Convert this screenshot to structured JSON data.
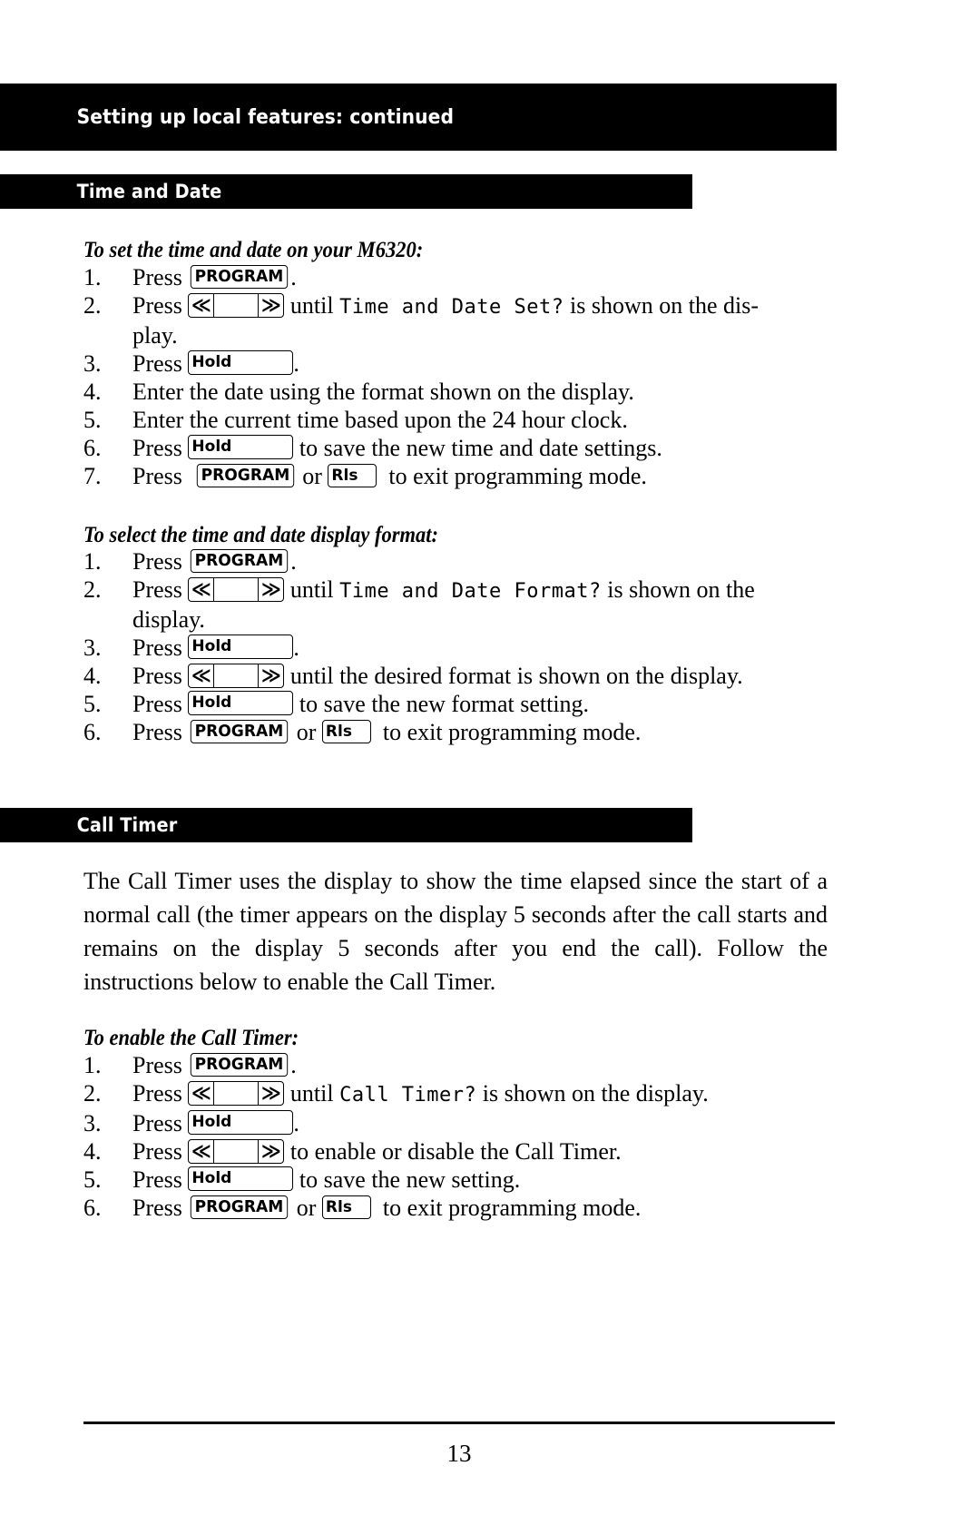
{
  "header": {
    "title": "Setting up local features: continued"
  },
  "sections": [
    {
      "bar_label": "Time and Date",
      "subsections": [
        {
          "heading": "To set the time and date on your M6320:",
          "steps": [
            {
              "num": "1.",
              "parts": [
                {
                  "t": "text",
                  "v": "Press "
                },
                {
                  "t": "key",
                  "kind": "program",
                  "label": "PROGRAM"
                },
                {
                  "t": "text",
                  "v": "."
                }
              ]
            },
            {
              "num": "2.",
              "parts": [
                {
                  "t": "text",
                  "v": "Press "
                },
                {
                  "t": "key",
                  "kind": "nav",
                  "left": "≪",
                  "right": "≫"
                },
                {
                  "t": "text",
                  "v": " until "
                },
                {
                  "t": "display",
                  "v": "Time and Date Set?"
                },
                {
                  "t": "text",
                  "v": " is shown on the dis-"
                },
                {
                  "t": "break"
                },
                {
                  "t": "text",
                  "v": "play."
                }
              ]
            },
            {
              "num": "3.",
              "parts": [
                {
                  "t": "text",
                  "v": "Press "
                },
                {
                  "t": "key",
                  "kind": "hold",
                  "label": "Hold"
                },
                {
                  "t": "text",
                  "v": "."
                }
              ]
            },
            {
              "num": "4.",
              "parts": [
                {
                  "t": "text",
                  "v": "Enter the date using the format shown on the display."
                }
              ]
            },
            {
              "num": "5.",
              "parts": [
                {
                  "t": "text",
                  "v": "Enter the current time based upon the 24 hour clock."
                }
              ]
            },
            {
              "num": "6.",
              "parts": [
                {
                  "t": "text",
                  "v": "Press "
                },
                {
                  "t": "key",
                  "kind": "hold",
                  "label": "Hold"
                },
                {
                  "t": "text",
                  "v": " to save the new time and date settings."
                }
              ]
            },
            {
              "num": "7.",
              "parts": [
                {
                  "t": "text",
                  "v": "Press  "
                },
                {
                  "t": "key",
                  "kind": "program",
                  "label": "PROGRAM"
                },
                {
                  "t": "text",
                  "v": " or "
                },
                {
                  "t": "key",
                  "kind": "rls",
                  "label": "Rls"
                },
                {
                  "t": "text",
                  "v": "  to exit programming mode."
                }
              ]
            }
          ]
        },
        {
          "heading": "To select the time and date display format:",
          "steps": [
            {
              "num": "1.",
              "parts": [
                {
                  "t": "text",
                  "v": "Press "
                },
                {
                  "t": "key",
                  "kind": "program",
                  "label": "PROGRAM"
                },
                {
                  "t": "text",
                  "v": "."
                }
              ]
            },
            {
              "num": "2.",
              "parts": [
                {
                  "t": "text",
                  "v": "Press "
                },
                {
                  "t": "key",
                  "kind": "nav",
                  "left": "≪",
                  "right": "≫"
                },
                {
                  "t": "text",
                  "v": " until "
                },
                {
                  "t": "display",
                  "v": "Time and Date Format?"
                },
                {
                  "t": "text",
                  "v": " is shown on the"
                },
                {
                  "t": "break"
                },
                {
                  "t": "text",
                  "v": "display."
                }
              ]
            },
            {
              "num": "3.",
              "parts": [
                {
                  "t": "text",
                  "v": "Press "
                },
                {
                  "t": "key",
                  "kind": "hold",
                  "label": "Hold"
                },
                {
                  "t": "text",
                  "v": "."
                }
              ]
            },
            {
              "num": "4.",
              "parts": [
                {
                  "t": "text",
                  "v": "Press "
                },
                {
                  "t": "key",
                  "kind": "nav",
                  "left": "≪",
                  "right": "≫"
                },
                {
                  "t": "text",
                  "v": " until the desired format is shown on the display."
                }
              ]
            },
            {
              "num": "5.",
              "parts": [
                {
                  "t": "text",
                  "v": "Press "
                },
                {
                  "t": "key",
                  "kind": "hold",
                  "label": "Hold"
                },
                {
                  "t": "text",
                  "v": " to save the new format setting."
                }
              ]
            },
            {
              "num": "6.",
              "parts": [
                {
                  "t": "text",
                  "v": "Press "
                },
                {
                  "t": "key",
                  "kind": "program",
                  "label": "PROGRAM"
                },
                {
                  "t": "text",
                  "v": " or "
                },
                {
                  "t": "key",
                  "kind": "rls",
                  "label": "Rls"
                },
                {
                  "t": "text",
                  "v": "  to exit programming mode."
                }
              ]
            }
          ]
        }
      ]
    },
    {
      "bar_label": "Call Timer",
      "paragraph": "The Call Timer uses the display to show the time elapsed since the start of a normal call (the timer appears on the display 5 seconds after the call starts and remains on the display 5 seconds after you end the call). Follow the instructions below to enable the Call Timer.",
      "subsections": [
        {
          "heading": "To enable the Call Timer:",
          "steps": [
            {
              "num": "1.",
              "parts": [
                {
                  "t": "text",
                  "v": "Press "
                },
                {
                  "t": "key",
                  "kind": "program",
                  "label": "PROGRAM"
                },
                {
                  "t": "text",
                  "v": "."
                }
              ]
            },
            {
              "num": "2.",
              "parts": [
                {
                  "t": "text",
                  "v": "Press "
                },
                {
                  "t": "key",
                  "kind": "nav",
                  "left": "≪",
                  "right": "≫"
                },
                {
                  "t": "text",
                  "v": " until "
                },
                {
                  "t": "display",
                  "v": "Call Timer?"
                },
                {
                  "t": "text",
                  "v": " is shown on the display."
                }
              ]
            },
            {
              "num": "3.",
              "parts": [
                {
                  "t": "text",
                  "v": "Press "
                },
                {
                  "t": "key",
                  "kind": "hold",
                  "label": "Hold"
                },
                {
                  "t": "text",
                  "v": "."
                }
              ]
            },
            {
              "num": "4.",
              "parts": [
                {
                  "t": "text",
                  "v": "Press "
                },
                {
                  "t": "key",
                  "kind": "nav",
                  "left": "≪",
                  "right": "≫"
                },
                {
                  "t": "text",
                  "v": " to enable or disable the Call Timer."
                }
              ]
            },
            {
              "num": "5.",
              "parts": [
                {
                  "t": "text",
                  "v": "Press "
                },
                {
                  "t": "key",
                  "kind": "hold",
                  "label": "Hold"
                },
                {
                  "t": "text",
                  "v": " to save the new setting."
                }
              ]
            },
            {
              "num": "6.",
              "parts": [
                {
                  "t": "text",
                  "v": "Press "
                },
                {
                  "t": "key",
                  "kind": "program",
                  "label": "PROGRAM"
                },
                {
                  "t": "text",
                  "v": " or "
                },
                {
                  "t": "key",
                  "kind": "rls",
                  "label": "Rls"
                },
                {
                  "t": "text",
                  "v": "  to exit programming mode."
                }
              ]
            }
          ]
        }
      ]
    }
  ],
  "footer": {
    "page_number": "13"
  }
}
